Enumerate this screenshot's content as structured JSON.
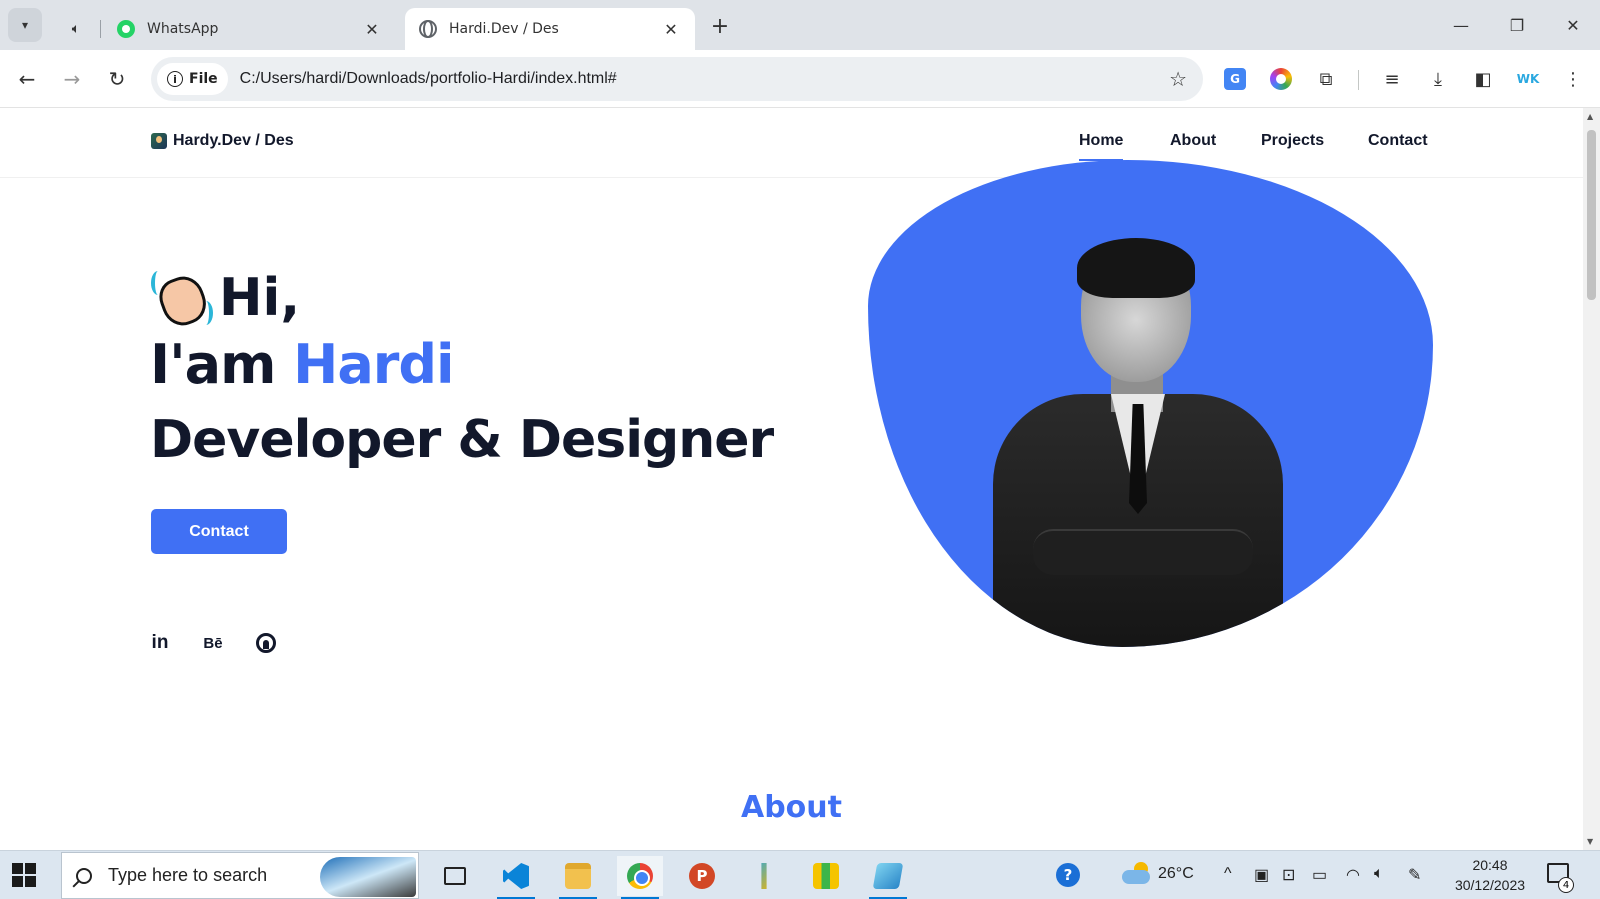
{
  "browser": {
    "tabs": [
      {
        "title": "WhatsApp",
        "active": false
      },
      {
        "title": "Hardi.Dev / Des",
        "active": true
      }
    ],
    "scheme_chip": "File",
    "url": "C:/Users/hardi/Downloads/portfolio-Hardi/index.html#",
    "extensions": [
      "google-translate-icon",
      "color-picker-icon",
      "extensions-puzzle-icon",
      "media-queue-icon",
      "download-icon",
      "side-panel-icon",
      "wk-extension-icon",
      "menu-icon"
    ],
    "ext_wk_label": "WK"
  },
  "site": {
    "logo_text": "Hardy.Dev / Des",
    "nav": [
      "Home",
      "About",
      "Projects",
      "Contact"
    ],
    "active_nav": "Home",
    "hero": {
      "greeting": "Hi,",
      "intro_prefix": "I'am ",
      "name": "Hardi",
      "role": "Developer & Designer",
      "cta_label": "Contact"
    },
    "social": {
      "linkedin": "in",
      "behance": "Bē"
    },
    "next_section_title": "About",
    "colors": {
      "accent": "#4070f4",
      "text_dark": "#12182b"
    }
  },
  "taskbar": {
    "search_placeholder": "Type here to search",
    "weather": "26°C",
    "time": "20:48",
    "date": "30/12/2023",
    "notification_count": "4",
    "ppt_letter": "P"
  }
}
